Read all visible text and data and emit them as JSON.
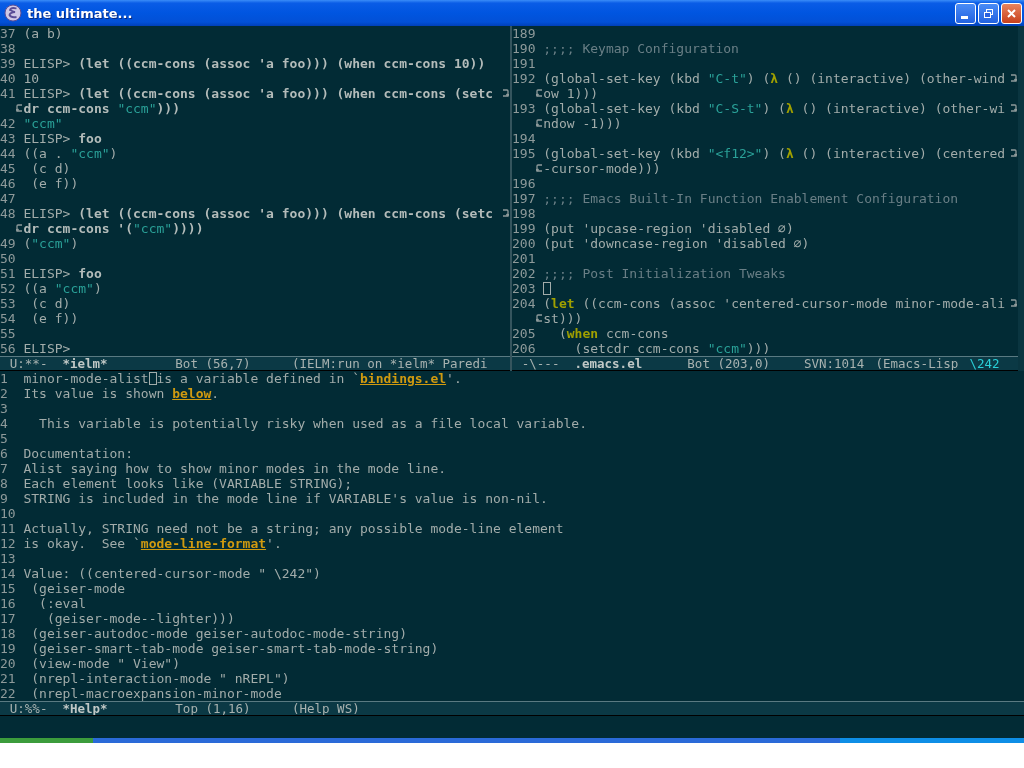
{
  "window": {
    "title": "the ultimate..."
  },
  "top_left_pane": {
    "lines": [
      {
        "kind": "line",
        "number": "37",
        "segments": [
          {
            "kind": "plain",
            "text": "(a b)"
          }
        ]
      },
      {
        "kind": "line",
        "number": "38"
      },
      {
        "kind": "line",
        "number": "39",
        "segments": [
          {
            "kind": "prompt",
            "text": "ELISP> "
          },
          {
            "kind": "input",
            "text": "(let ((ccm-cons (assoc 'a foo))) (when ccm-cons 10))"
          }
        ]
      },
      {
        "kind": "line",
        "number": "40",
        "segments": [
          {
            "kind": "plain",
            "text": "10"
          }
        ]
      },
      {
        "kind": "line",
        "number": "41",
        "segments": [
          {
            "kind": "prompt",
            "text": "ELISP> "
          },
          {
            "kind": "input",
            "text": "(let ((ccm-cons (assoc 'a foo))) (when ccm-cons (setc"
          }
        ]
      },
      {
        "kind": "continuation",
        "segments": [
          {
            "kind": "input",
            "text": "dr ccm-cons "
          },
          {
            "kind": "string",
            "text": "\"ccm\""
          },
          {
            "kind": "input",
            "text": ")))"
          }
        ]
      },
      {
        "kind": "line",
        "number": "42",
        "segments": [
          {
            "kind": "string",
            "text": "\"ccm\""
          }
        ]
      },
      {
        "kind": "line",
        "number": "43",
        "segments": [
          {
            "kind": "prompt",
            "text": "ELISP> "
          },
          {
            "kind": "input",
            "text": "foo"
          }
        ]
      },
      {
        "kind": "line",
        "number": "44",
        "segments": [
          {
            "kind": "plain",
            "text": "((a . "
          },
          {
            "kind": "string",
            "text": "\"ccm\""
          },
          {
            "kind": "plain",
            "text": ")"
          }
        ]
      },
      {
        "kind": "line",
        "number": "45",
        "segments": [
          {
            "kind": "plain",
            "text": " (c d)"
          }
        ]
      },
      {
        "kind": "line",
        "number": "46",
        "segments": [
          {
            "kind": "plain",
            "text": " (e f))"
          }
        ]
      },
      {
        "kind": "line",
        "number": "47"
      },
      {
        "kind": "line",
        "number": "48",
        "segments": [
          {
            "kind": "prompt",
            "text": "ELISP> "
          },
          {
            "kind": "input",
            "text": "(let ((ccm-cons (assoc 'a foo))) (when ccm-cons (setc"
          }
        ]
      },
      {
        "kind": "continuation",
        "segments": [
          {
            "kind": "input",
            "text": "dr ccm-cons '("
          },
          {
            "kind": "string",
            "text": "\"ccm\""
          },
          {
            "kind": "input",
            "text": "))))"
          }
        ]
      },
      {
        "kind": "line",
        "number": "49",
        "segments": [
          {
            "kind": "plain",
            "text": "("
          },
          {
            "kind": "string",
            "text": "\"ccm\""
          },
          {
            "kind": "plain",
            "text": ")"
          }
        ]
      },
      {
        "kind": "line",
        "number": "50"
      },
      {
        "kind": "line",
        "number": "51",
        "segments": [
          {
            "kind": "prompt",
            "text": "ELISP> "
          },
          {
            "kind": "input",
            "text": "foo"
          }
        ]
      },
      {
        "kind": "line",
        "number": "52",
        "segments": [
          {
            "kind": "plain",
            "text": "((a "
          },
          {
            "kind": "string",
            "text": "\"ccm\""
          },
          {
            "kind": "plain",
            "text": ")"
          }
        ]
      },
      {
        "kind": "line",
        "number": "53",
        "segments": [
          {
            "kind": "plain",
            "text": " (c d)"
          }
        ]
      },
      {
        "kind": "line",
        "number": "54",
        "segments": [
          {
            "kind": "plain",
            "text": " (e f))"
          }
        ]
      },
      {
        "kind": "line",
        "number": "55"
      },
      {
        "kind": "line",
        "number": "56",
        "segments": [
          {
            "kind": "prompt",
            "text": "ELISP>"
          }
        ]
      }
    ],
    "mode_line": [
      {
        "kind": "status",
        "text": "U:**-"
      },
      {
        "kind": "buffer",
        "text": "*ielm*"
      },
      {
        "kind": "position",
        "text": "Bot (56,7)"
      },
      {
        "kind": "info",
        "text": "(IELM:run on *ielm* Paredi"
      }
    ]
  },
  "top_right_pane": {
    "lines": [
      {
        "kind": "line",
        "number": "189"
      },
      {
        "kind": "line",
        "number": "190",
        "segments": [
          {
            "kind": "comment",
            "text": ";;;; Keymap Configuration"
          }
        ]
      },
      {
        "kind": "line",
        "number": "191"
      },
      {
        "kind": "line",
        "number": "192",
        "segments": [
          {
            "kind": "plain",
            "text": "(global-set-key (kbd "
          },
          {
            "kind": "string",
            "text": "\"C-t\""
          },
          {
            "kind": "plain",
            "text": ") ("
          },
          {
            "kind": "keyword",
            "text": "λ"
          },
          {
            "kind": "plain",
            "text": " () (interactive) (other-wind"
          }
        ]
      },
      {
        "kind": "continuation",
        "segments": [
          {
            "kind": "plain",
            "text": "ow 1)))"
          }
        ]
      },
      {
        "kind": "line",
        "number": "193",
        "segments": [
          {
            "kind": "plain",
            "text": "(global-set-key (kbd "
          },
          {
            "kind": "string",
            "text": "\"C-S-t\""
          },
          {
            "kind": "plain",
            "text": ") ("
          },
          {
            "kind": "keyword",
            "text": "λ"
          },
          {
            "kind": "plain",
            "text": " () (interactive) (other-wi"
          }
        ]
      },
      {
        "kind": "continuation",
        "segments": [
          {
            "kind": "plain",
            "text": "ndow -1)))"
          }
        ]
      },
      {
        "kind": "line",
        "number": "194"
      },
      {
        "kind": "line",
        "number": "195",
        "segments": [
          {
            "kind": "plain",
            "text": "(global-set-key (kbd "
          },
          {
            "kind": "string",
            "text": "\"<f12>\""
          },
          {
            "kind": "plain",
            "text": ") ("
          },
          {
            "kind": "keyword",
            "text": "λ"
          },
          {
            "kind": "plain",
            "text": " () (interactive) (centered"
          }
        ]
      },
      {
        "kind": "continuation",
        "segments": [
          {
            "kind": "plain",
            "text": "-cursor-mode)))"
          }
        ]
      },
      {
        "kind": "line",
        "number": "196"
      },
      {
        "kind": "line",
        "number": "197",
        "segments": [
          {
            "kind": "comment",
            "text": ";;;; Emacs Built-In Function Enablement Configuration"
          }
        ]
      },
      {
        "kind": "line",
        "number": "198"
      },
      {
        "kind": "line",
        "number": "199",
        "segments": [
          {
            "kind": "plain",
            "text": "(put 'upcase-region 'disabled ∅)"
          }
        ]
      },
      {
        "kind": "line",
        "number": "200",
        "segments": [
          {
            "kind": "plain",
            "text": "(put 'downcase-region 'disabled ∅)"
          }
        ]
      },
      {
        "kind": "line",
        "number": "201"
      },
      {
        "kind": "line",
        "number": "202",
        "segments": [
          {
            "kind": "comment",
            "text": ";;;; Post Initialization Tweaks"
          }
        ]
      },
      {
        "kind": "line",
        "number": "203",
        "segments": [
          {
            "kind": "cursor"
          }
        ]
      },
      {
        "kind": "line",
        "number": "204",
        "segments": [
          {
            "kind": "plain",
            "text": "("
          },
          {
            "kind": "keyword",
            "text": "let"
          },
          {
            "kind": "plain",
            "text": " ((ccm-cons (assoc 'centered-cursor-mode minor-mode-ali"
          }
        ]
      },
      {
        "kind": "continuation",
        "segments": [
          {
            "kind": "plain",
            "text": "st)))"
          }
        ]
      },
      {
        "kind": "line",
        "number": "205",
        "segments": [
          {
            "kind": "plain",
            "text": "  ("
          },
          {
            "kind": "keyword",
            "text": "when"
          },
          {
            "kind": "plain",
            "text": " ccm-cons"
          }
        ]
      },
      {
        "kind": "line",
        "number": "206",
        "segments": [
          {
            "kind": "plain",
            "text": "    (setcdr ccm-cons "
          },
          {
            "kind": "string",
            "text": "\"ccm\""
          },
          {
            "kind": "plain",
            "text": ")))"
          }
        ]
      }
    ],
    "mode_line": [
      {
        "kind": "status",
        "text": "-\\---"
      },
      {
        "kind": "buffer",
        "text": ".emacs.el"
      },
      {
        "kind": "position",
        "text": "Bot (203,0)"
      },
      {
        "kind": "info",
        "text": "SVN:1014"
      },
      {
        "kind": "info",
        "text": "(Emacs-Lisp"
      },
      {
        "kind": "lighter",
        "text": "\\242"
      }
    ]
  },
  "help_pane": {
    "lines": [
      {
        "kind": "line",
        "number": "1",
        "segments": [
          {
            "kind": "plain",
            "text": "minor-mode-alist"
          },
          {
            "kind": "cursor"
          },
          {
            "kind": "plain",
            "text": "is a variable defined in `"
          },
          {
            "kind": "link",
            "text": "bindings.el"
          },
          {
            "kind": "plain",
            "text": "'."
          }
        ]
      },
      {
        "kind": "line",
        "number": "2",
        "segments": [
          {
            "kind": "plain",
            "text": "Its value is shown "
          },
          {
            "kind": "link",
            "text": "below"
          },
          {
            "kind": "plain",
            "text": "."
          }
        ]
      },
      {
        "kind": "line",
        "number": "3"
      },
      {
        "kind": "line",
        "number": "4",
        "segments": [
          {
            "kind": "plain",
            "text": "  This variable is potentially risky when used as a file local variable."
          }
        ]
      },
      {
        "kind": "line",
        "number": "5"
      },
      {
        "kind": "line",
        "number": "6",
        "segments": [
          {
            "kind": "plain",
            "text": "Documentation:"
          }
        ]
      },
      {
        "kind": "line",
        "number": "7",
        "segments": [
          {
            "kind": "plain",
            "text": "Alist saying how to show minor modes in the mode line."
          }
        ]
      },
      {
        "kind": "line",
        "number": "8",
        "segments": [
          {
            "kind": "plain",
            "text": "Each element looks like (VARIABLE STRING);"
          }
        ]
      },
      {
        "kind": "line",
        "number": "9",
        "segments": [
          {
            "kind": "plain",
            "text": "STRING is included in the mode line if VARIABLE's value is non-nil."
          }
        ]
      },
      {
        "kind": "line",
        "number": "10"
      },
      {
        "kind": "line",
        "number": "11",
        "segments": [
          {
            "kind": "plain",
            "text": "Actually, STRING need not be a string; any possible mode-line element"
          }
        ]
      },
      {
        "kind": "line",
        "number": "12",
        "segments": [
          {
            "kind": "plain",
            "text": "is okay.  See `"
          },
          {
            "kind": "link",
            "text": "mode-line-format"
          },
          {
            "kind": "plain",
            "text": "'."
          }
        ]
      },
      {
        "kind": "line",
        "number": "13"
      },
      {
        "kind": "line",
        "number": "14",
        "segments": [
          {
            "kind": "plain",
            "text": "Value: ((centered-cursor-mode \" \\242\")"
          }
        ]
      },
      {
        "kind": "line",
        "number": "15",
        "segments": [
          {
            "kind": "plain",
            "text": " (geiser-mode"
          }
        ]
      },
      {
        "kind": "line",
        "number": "16",
        "segments": [
          {
            "kind": "plain",
            "text": "  (:eval"
          }
        ]
      },
      {
        "kind": "line",
        "number": "17",
        "segments": [
          {
            "kind": "plain",
            "text": "   (geiser-mode--lighter)))"
          }
        ]
      },
      {
        "kind": "line",
        "number": "18",
        "segments": [
          {
            "kind": "plain",
            "text": " (geiser-autodoc-mode geiser-autodoc-mode-string)"
          }
        ]
      },
      {
        "kind": "line",
        "number": "19",
        "segments": [
          {
            "kind": "plain",
            "text": " (geiser-smart-tab-mode geiser-smart-tab-mode-string)"
          }
        ]
      },
      {
        "kind": "line",
        "number": "20",
        "segments": [
          {
            "kind": "plain",
            "text": " (view-mode \" View\")"
          }
        ]
      },
      {
        "kind": "line",
        "number": "21",
        "segments": [
          {
            "kind": "plain",
            "text": " (nrepl-interaction-mode \" nREPL\")"
          }
        ]
      },
      {
        "kind": "line",
        "number": "22",
        "segments": [
          {
            "kind": "plain",
            "text": " (nrepl-macroexpansion-minor-mode"
          }
        ]
      }
    ],
    "mode_line": [
      {
        "kind": "status",
        "text": "U:%%-"
      },
      {
        "kind": "buffer",
        "text": "*Help*"
      },
      {
        "kind": "position",
        "text": "Top (1,16)"
      },
      {
        "kind": "info",
        "text": "(Help WS)"
      }
    ]
  }
}
